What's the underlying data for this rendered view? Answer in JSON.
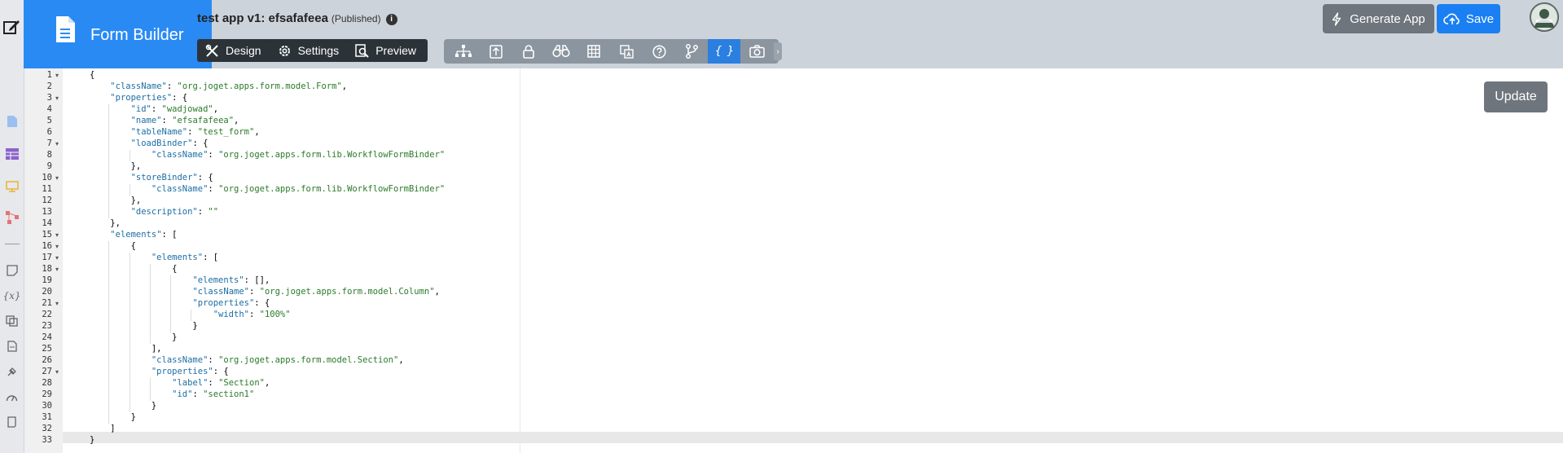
{
  "brand": {
    "title": "Form Builder"
  },
  "app": {
    "name": "test app v1: efsafafeea",
    "status": "(Published)"
  },
  "modes": [
    {
      "label": "Design",
      "icon": "design-tools-icon"
    },
    {
      "label": "Settings",
      "icon": "gear-icon"
    },
    {
      "label": "Preview",
      "icon": "preview-icon"
    }
  ],
  "toolbar": {
    "icons": [
      "tree-icon",
      "upload-icon",
      "lock-icon",
      "binoculars-icon",
      "table-icon",
      "translate-icon",
      "help-icon",
      "branch-icon",
      "json-braces-icon",
      "camera-icon"
    ],
    "active_index": 8,
    "braces_glyph": "{ }",
    "more": "›"
  },
  "actions": {
    "generate": "Generate App",
    "save": "Save",
    "update": "Update"
  },
  "colors": {
    "brand": "#2a8af4",
    "save": "#1a7ff2",
    "header_bg": "#cdd3db",
    "active_tool": "#2a7fe0"
  },
  "editor": {
    "lines": [
      [
        [
          "p",
          "{"
        ]
      ],
      [
        [
          "p",
          "    "
        ],
        [
          "k",
          "\"className\""
        ],
        [
          "p",
          ": "
        ],
        [
          "s",
          "\"org.joget.apps.form.model.Form\""
        ],
        [
          "p",
          ","
        ]
      ],
      [
        [
          "p",
          "    "
        ],
        [
          "k",
          "\"properties\""
        ],
        [
          "p",
          ": {"
        ]
      ],
      [
        [
          "p",
          "        "
        ],
        [
          "k",
          "\"id\""
        ],
        [
          "p",
          ": "
        ],
        [
          "s",
          "\"wadjowad\""
        ],
        [
          "p",
          ","
        ]
      ],
      [
        [
          "p",
          "        "
        ],
        [
          "k",
          "\"name\""
        ],
        [
          "p",
          ": "
        ],
        [
          "s",
          "\"efsafafeea\""
        ],
        [
          "p",
          ","
        ]
      ],
      [
        [
          "p",
          "        "
        ],
        [
          "k",
          "\"tableName\""
        ],
        [
          "p",
          ": "
        ],
        [
          "s",
          "\"test_form\""
        ],
        [
          "p",
          ","
        ]
      ],
      [
        [
          "p",
          "        "
        ],
        [
          "k",
          "\"loadBinder\""
        ],
        [
          "p",
          ": {"
        ]
      ],
      [
        [
          "p",
          "            "
        ],
        [
          "k",
          "\"className\""
        ],
        [
          "p",
          ": "
        ],
        [
          "s",
          "\"org.joget.apps.form.lib.WorkflowFormBinder\""
        ]
      ],
      [
        [
          "p",
          "        },"
        ]
      ],
      [
        [
          "p",
          "        "
        ],
        [
          "k",
          "\"storeBinder\""
        ],
        [
          "p",
          ": {"
        ]
      ],
      [
        [
          "p",
          "            "
        ],
        [
          "k",
          "\"className\""
        ],
        [
          "p",
          ": "
        ],
        [
          "s",
          "\"org.joget.apps.form.lib.WorkflowFormBinder\""
        ]
      ],
      [
        [
          "p",
          "        },"
        ]
      ],
      [
        [
          "p",
          "        "
        ],
        [
          "k",
          "\"description\""
        ],
        [
          "p",
          ": "
        ],
        [
          "s",
          "\"\""
        ]
      ],
      [
        [
          "p",
          "    },"
        ]
      ],
      [
        [
          "p",
          "    "
        ],
        [
          "k",
          "\"elements\""
        ],
        [
          "p",
          ": ["
        ]
      ],
      [
        [
          "p",
          "        {"
        ]
      ],
      [
        [
          "p",
          "            "
        ],
        [
          "k",
          "\"elements\""
        ],
        [
          "p",
          ": ["
        ]
      ],
      [
        [
          "p",
          "                {"
        ]
      ],
      [
        [
          "p",
          "                    "
        ],
        [
          "k",
          "\"elements\""
        ],
        [
          "p",
          ": [],"
        ]
      ],
      [
        [
          "p",
          "                    "
        ],
        [
          "k",
          "\"className\""
        ],
        [
          "p",
          ": "
        ],
        [
          "s",
          "\"org.joget.apps.form.model.Column\""
        ],
        [
          "p",
          ","
        ]
      ],
      [
        [
          "p",
          "                    "
        ],
        [
          "k",
          "\"properties\""
        ],
        [
          "p",
          ": {"
        ]
      ],
      [
        [
          "p",
          "                        "
        ],
        [
          "k",
          "\"width\""
        ],
        [
          "p",
          ": "
        ],
        [
          "s",
          "\"100%\""
        ]
      ],
      [
        [
          "p",
          "                    }"
        ]
      ],
      [
        [
          "p",
          "                }"
        ]
      ],
      [
        [
          "p",
          "            ],"
        ]
      ],
      [
        [
          "p",
          "            "
        ],
        [
          "k",
          "\"className\""
        ],
        [
          "p",
          ": "
        ],
        [
          "s",
          "\"org.joget.apps.form.model.Section\""
        ],
        [
          "p",
          ","
        ]
      ],
      [
        [
          "p",
          "            "
        ],
        [
          "k",
          "\"properties\""
        ],
        [
          "p",
          ": {"
        ]
      ],
      [
        [
          "p",
          "                "
        ],
        [
          "k",
          "\"label\""
        ],
        [
          "p",
          ": "
        ],
        [
          "s",
          "\"Section\""
        ],
        [
          "p",
          ","
        ]
      ],
      [
        [
          "p",
          "                "
        ],
        [
          "k",
          "\"id\""
        ],
        [
          "p",
          ": "
        ],
        [
          "s",
          "\"section1\""
        ]
      ],
      [
        [
          "p",
          "            }"
        ]
      ],
      [
        [
          "p",
          "        }"
        ]
      ],
      [
        [
          "p",
          "    ]"
        ]
      ],
      [
        [
          "p",
          "}"
        ]
      ]
    ],
    "fold_lines": [
      1,
      3,
      7,
      10,
      15,
      16,
      17,
      18,
      21,
      27
    ]
  }
}
